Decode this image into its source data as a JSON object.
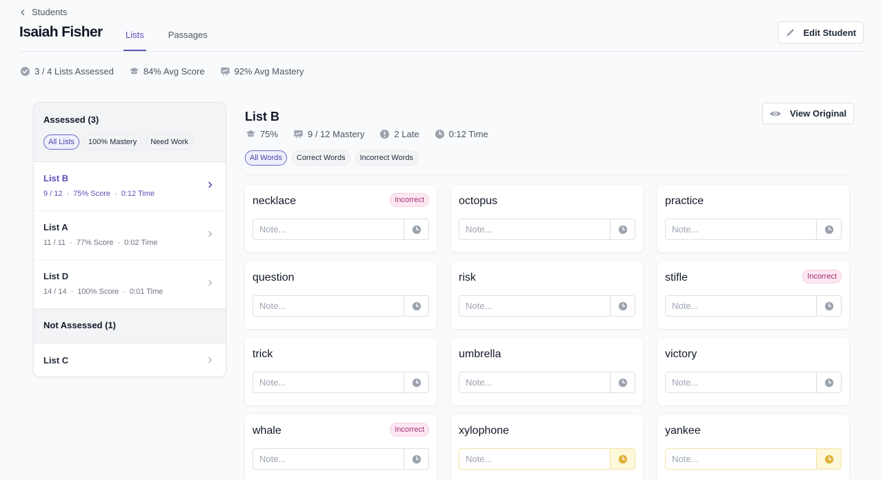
{
  "breadcrumb": {
    "back_label": "Students"
  },
  "student": {
    "name": "Isaiah Fisher"
  },
  "tabs": [
    {
      "label": "Lists",
      "active": true
    },
    {
      "label": "Passages",
      "active": false
    }
  ],
  "actions": {
    "edit_label": "Edit Student",
    "view_original_label": "View Original"
  },
  "summary_stats": [
    {
      "icon": "check-circle-icon",
      "label": "3 / 4 Lists Assessed"
    },
    {
      "icon": "graduation-cap-icon",
      "label": "84% Avg Score"
    },
    {
      "icon": "presentation-chart-icon",
      "label": "92% Avg Mastery"
    }
  ],
  "sidebar": {
    "assessed_title": "Assessed (3)",
    "filters": [
      {
        "label": "All Lists",
        "active": true
      },
      {
        "label": "100% Mastery",
        "active": false
      },
      {
        "label": "Need Work",
        "active": false
      }
    ],
    "assessed_lists": [
      {
        "title": "List B",
        "words": "9 / 12",
        "score": "75% Score",
        "time": "0:12 Time",
        "active": true
      },
      {
        "title": "List A",
        "words": "11 / 11",
        "score": "77% Score",
        "time": "0:02 Time",
        "active": false
      },
      {
        "title": "List D",
        "words": "14 / 14",
        "score": "100% Score",
        "time": "0:01 Time",
        "active": false
      }
    ],
    "not_assessed_title": "Not Assessed (1)",
    "not_assessed_lists": [
      {
        "title": "List C"
      }
    ],
    "separator": "·"
  },
  "selected_list": {
    "title": "List B",
    "stats": [
      {
        "icon": "graduation-cap-icon",
        "label": "75%"
      },
      {
        "icon": "presentation-chart-icon",
        "label": "9 / 12 Mastery"
      },
      {
        "icon": "exclamation-circle-icon",
        "label": "2 Late"
      },
      {
        "icon": "clock-icon",
        "label": "0:12 Time"
      }
    ],
    "word_filters": [
      {
        "label": "All Words",
        "active": true
      },
      {
        "label": "Correct Words",
        "active": false
      },
      {
        "label": "Incorrect Words",
        "active": false
      }
    ],
    "note_placeholder": "Note...",
    "incorrect_label": "Incorrect",
    "words": [
      {
        "word": "necklace",
        "incorrect": true,
        "late": false
      },
      {
        "word": "octopus",
        "incorrect": false,
        "late": false
      },
      {
        "word": "practice",
        "incorrect": false,
        "late": false
      },
      {
        "word": "question",
        "incorrect": false,
        "late": false
      },
      {
        "word": "risk",
        "incorrect": false,
        "late": false
      },
      {
        "word": "stifle",
        "incorrect": true,
        "late": false
      },
      {
        "word": "trick",
        "incorrect": false,
        "late": false
      },
      {
        "word": "umbrella",
        "incorrect": false,
        "late": false
      },
      {
        "word": "victory",
        "incorrect": false,
        "late": false
      },
      {
        "word": "whale",
        "incorrect": true,
        "late": false
      },
      {
        "word": "xylophone",
        "incorrect": false,
        "late": true
      },
      {
        "word": "yankee",
        "incorrect": false,
        "late": true
      }
    ]
  },
  "colors": {
    "accent": "#5b4fb8",
    "incorrect_text": "#a0306b",
    "incorrect_bg": "#fce7f3",
    "late_icon": "#e0b03a",
    "late_bg": "#fdf8d9",
    "icon_gray": "#9ca3af"
  }
}
